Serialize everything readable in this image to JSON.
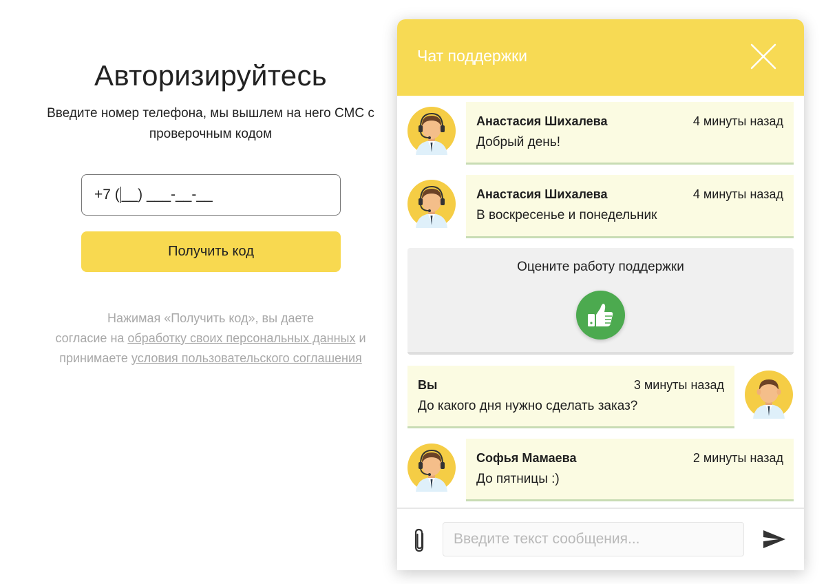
{
  "auth": {
    "title": "Авторизируйтесь",
    "subtitle_line1": "Введите номер телефона, мы вышлем на него СМС с",
    "subtitle_line2": "проверочным кодом",
    "phone_prefix": "+7 (",
    "phone_rest": "__) ___-__-__",
    "get_code_label": "Получить код",
    "consent_line1": "Нажимая «Получить код», вы  даете",
    "consent_line2_pre": "согласие на ",
    "consent_link1": "обработку своих персональных данных",
    "consent_line2_post": " и",
    "consent_line3_pre": "принимаете ",
    "consent_link2": "условия пользовательского соглашения"
  },
  "chat": {
    "title": "Чат поддержки",
    "messages": [
      {
        "author": "Анастасия Шихалева",
        "time": "4 минуты назад",
        "text": "Добрый день!",
        "side": "left"
      },
      {
        "author": "Анастасия Шихалева",
        "time": "4 минуты назад",
        "text": "В воскресенье и понедельник",
        "side": "left"
      },
      {
        "author": "Вы",
        "time": "3 минуты назад",
        "text": "До какого дня нужно сделать заказ?",
        "side": "right"
      },
      {
        "author": "Софья Мамаева",
        "time": "2 минуты назад",
        "text": "До пятницы :)",
        "side": "left"
      }
    ],
    "rating": {
      "title": "Оцените работу поддержки",
      "icon": "thumbs-up-icon"
    },
    "composer": {
      "placeholder": "Введите текст сообщения...",
      "attach_icon": "paperclip-icon",
      "send_icon": "send-icon"
    }
  },
  "colors": {
    "accent_yellow": "#f7da54",
    "bubble": "#fbfbe2",
    "bubble_border": "#c8dcb4",
    "like_green": "#4caa4f",
    "muted_text": "#a8a8a8"
  }
}
